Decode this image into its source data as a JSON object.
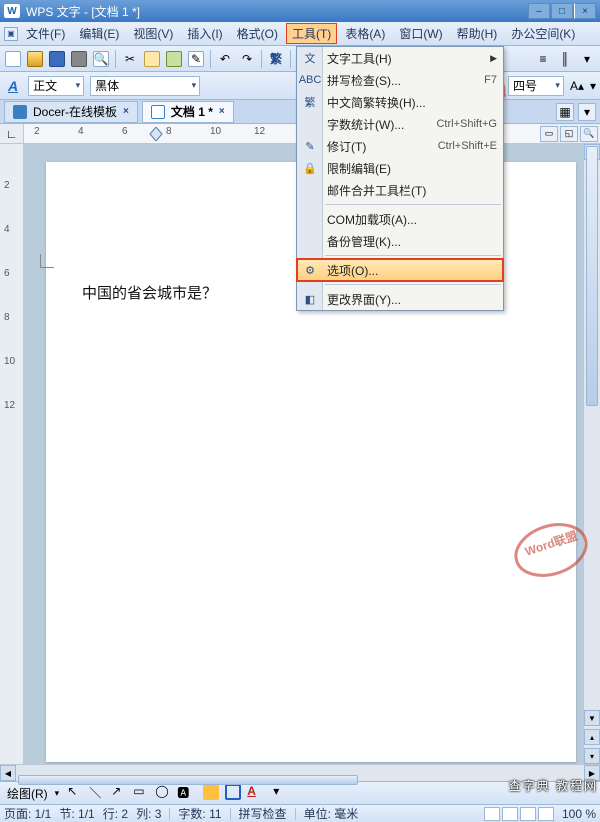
{
  "window": {
    "app_glyph": "W",
    "title": "WPS 文字 - [文档 1 *]",
    "min": "–",
    "restore": "□",
    "close": "×"
  },
  "menubar": {
    "items": [
      "文件(F)",
      "编辑(E)",
      "视图(V)",
      "插入(I)",
      "格式(O)",
      "工具(T)",
      "表格(A)",
      "窗口(W)",
      "帮助(H)",
      "办公空间(K)"
    ],
    "selected_index": 5
  },
  "toolbar_main": {
    "trad_label": "繁"
  },
  "fmtbar": {
    "style": "正文",
    "font": "黑体",
    "size": "四号"
  },
  "tabs": {
    "t0": {
      "label": "Docer-在线模板"
    },
    "t1": {
      "label": "文档 1 *"
    }
  },
  "ruler_h": {
    "numbers": [
      "2",
      "",
      "4",
      "",
      "6",
      "",
      "8",
      "",
      "10",
      "",
      "12"
    ]
  },
  "ruler_v": {
    "numbers": [
      "",
      "2",
      "",
      "4",
      "",
      "6",
      "",
      "8",
      "",
      "10",
      "",
      "12",
      ""
    ]
  },
  "document": {
    "body_text": "中国的省会城市是？"
  },
  "tools_menu": {
    "items": [
      {
        "label": "文字工具(H)",
        "icon": "文",
        "submenu": true
      },
      {
        "label": "拼写检查(S)...",
        "icon": "ABC",
        "shortcut": "F7"
      },
      {
        "label": "中文简繁转换(H)...",
        "icon": "繁"
      },
      {
        "label": "字数统计(W)...",
        "shortcut": "Ctrl+Shift+G"
      },
      {
        "label": "修订(T)",
        "icon": "✎",
        "shortcut": "Ctrl+Shift+E"
      },
      {
        "label": "限制编辑(E)",
        "icon": "🔒"
      },
      {
        "label": "邮件合并工具栏(T)"
      },
      {
        "sep": true
      },
      {
        "label": "COM加载项(A)..."
      },
      {
        "label": "备份管理(K)..."
      },
      {
        "sep": true
      },
      {
        "label": "选项(O)...",
        "icon": "⚙",
        "highlight": true
      },
      {
        "sep": true
      },
      {
        "label": "更改界面(Y)...",
        "icon": "◧"
      }
    ]
  },
  "drawbar": {
    "label": "绘图(R)"
  },
  "status": {
    "page": "页面: 1/1",
    "section": "节: 1/1",
    "row": "行: 2",
    "col": "列: 3",
    "words": "字数: 11",
    "spell": "拼写检查",
    "unit": "单位: 毫米",
    "zoom": "100 %"
  },
  "watermark_bottom": "查字典 教程网"
}
